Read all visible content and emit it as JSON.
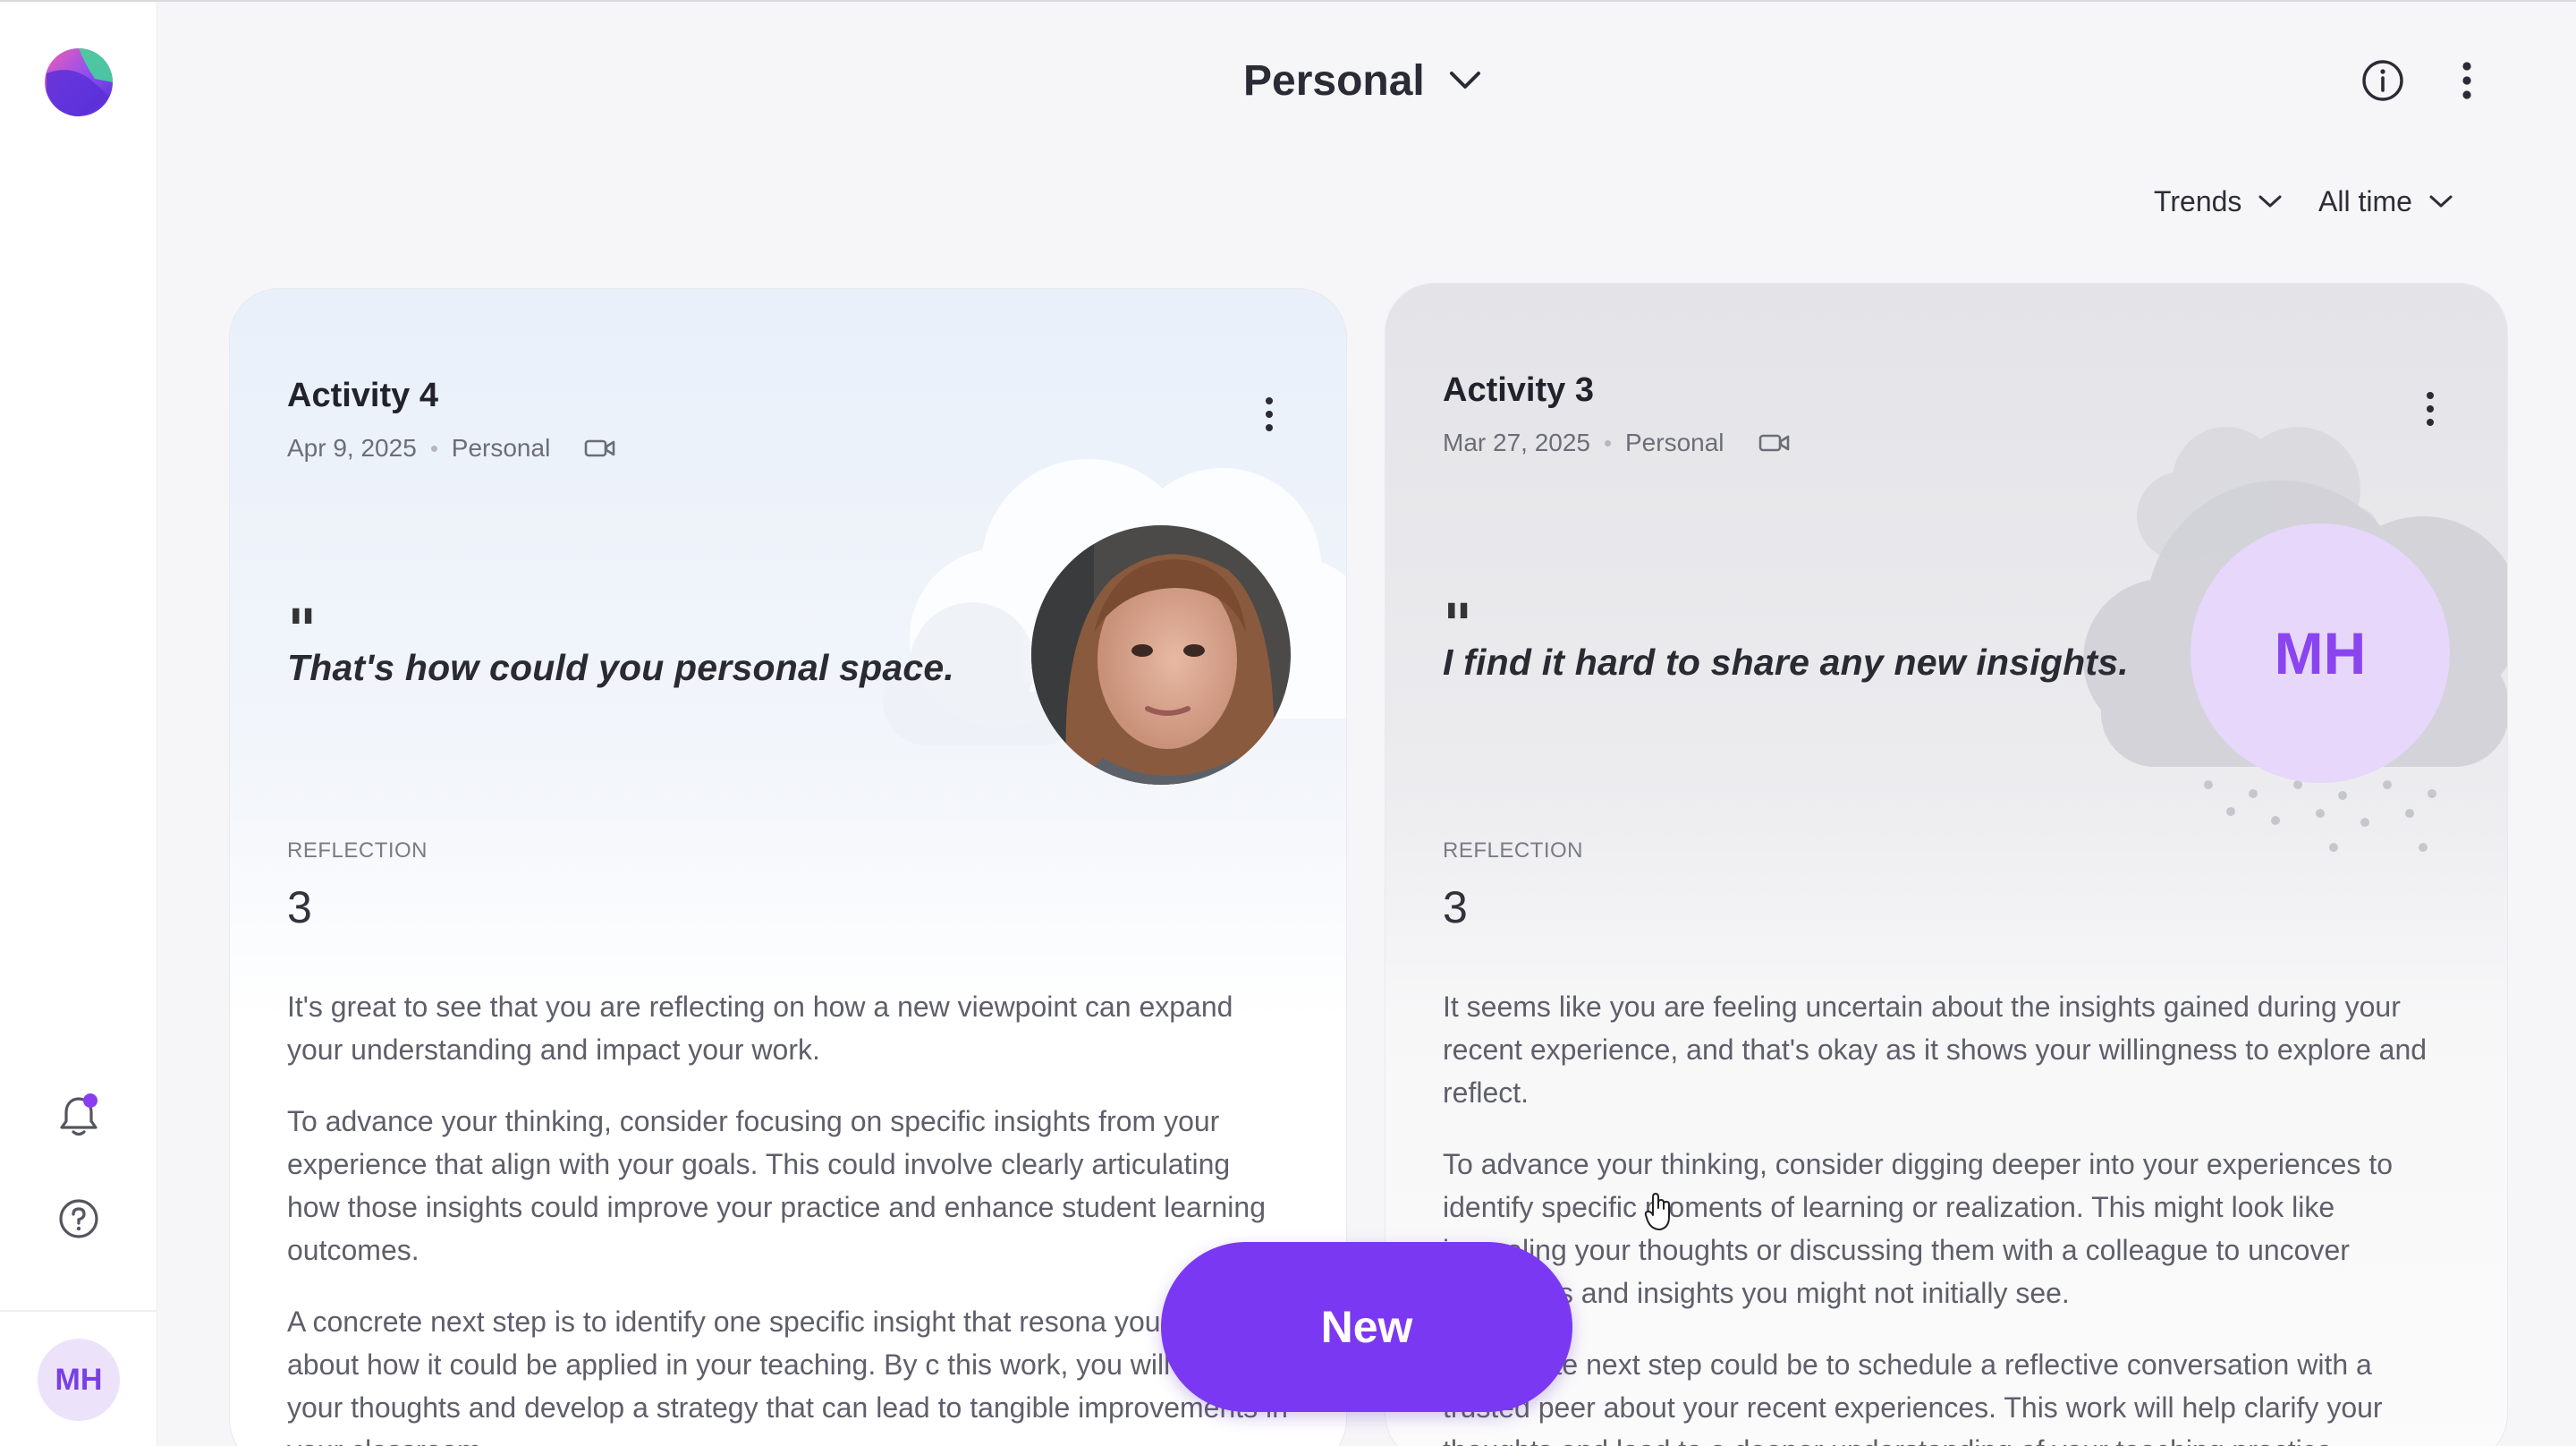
{
  "sidebar": {
    "avatar_initials": "MH"
  },
  "header": {
    "title": "Personal"
  },
  "filters": {
    "trends_label": "Trends",
    "time_label": "All time"
  },
  "cards": [
    {
      "title": "Activity 4",
      "date": "Apr 9, 2025",
      "category": "Personal",
      "quote_mark": "\"",
      "quote": "That's how could you personal space.",
      "reflection_label": "REFLECTION",
      "reflection_value": "3",
      "paragraphs": [
        "It's great to see that you are reflecting on how a new viewpoint can expand your understanding and impact your work.",
        "To advance your thinking, consider focusing on specific insights from your experience that align with your goals. This could involve clearly articulating how those insights could improve your practice and enhance student learning outcomes.",
        "A concrete next step is to identify one specific insight that resona you and write about how it could be applied in your teaching. By c this work, you will clarify your thoughts and develop a strategy that can lead to tangible improvements in your classroom."
      ]
    },
    {
      "title": "Activity 3",
      "date": "Mar 27, 2025",
      "category": "Personal",
      "quote_mark": "\"",
      "quote": "I find it hard to share any new insights.",
      "avatar_initials": "MH",
      "reflection_label": "REFLECTION",
      "reflection_value": "3",
      "paragraphs": [
        "It seems like you are feeling uncertain about the insights gained during your recent experience, and that's okay as it shows your willingness to explore and reflect.",
        "To advance your thinking, consider digging deeper into your experiences to identify specific moments of learning or realization. This might look like journaling your thoughts or discussing them with a colleague to uncover reflections and insights you might not initially see.",
        "A concrete next step could be to schedule a reflective conversation with a trusted peer about your recent experiences. This work will help clarify your thoughts and lead to a deeper understanding of your teaching practice."
      ]
    }
  ],
  "new_button": {
    "label": "New"
  },
  "colors": {
    "accent": "#7b38f2",
    "avatar_bg": "#e6d7fb"
  }
}
